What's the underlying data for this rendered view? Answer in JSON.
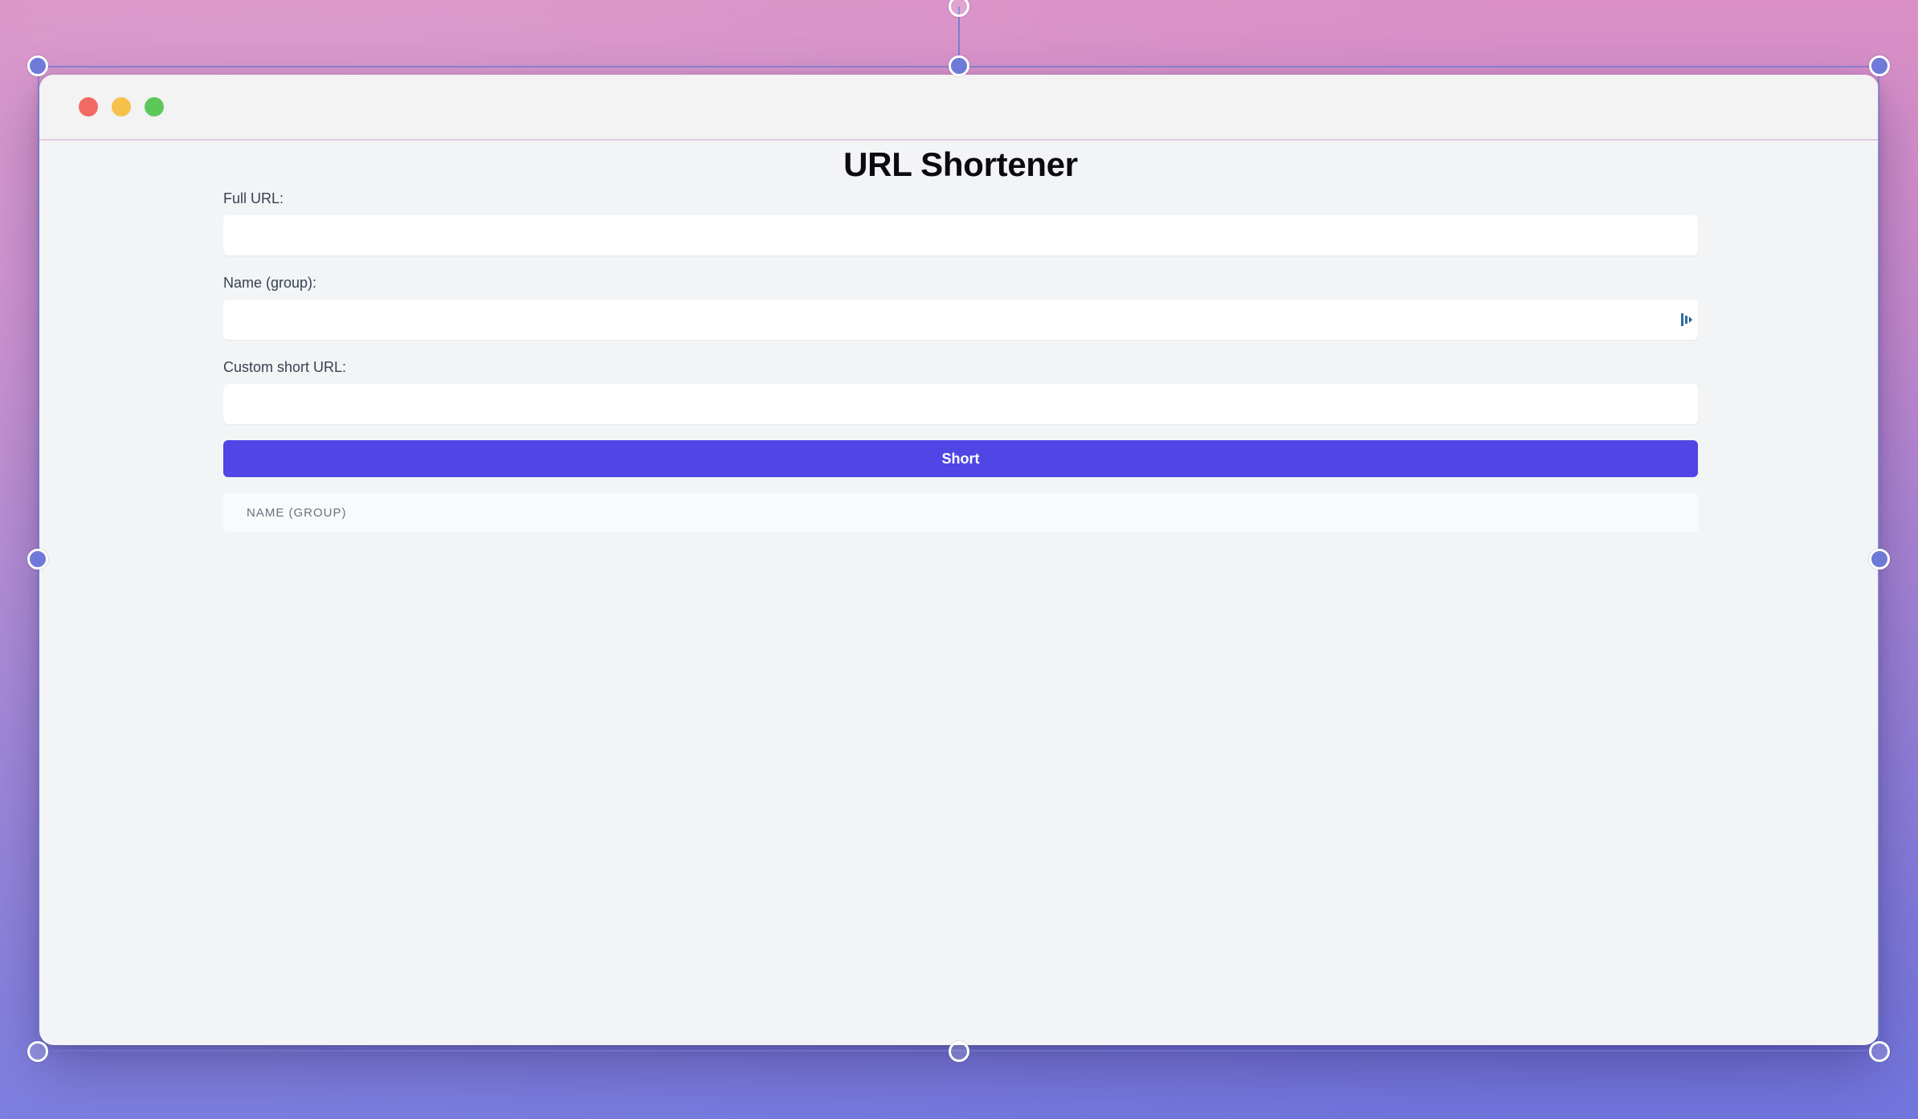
{
  "app": {
    "title": "URL Shortener"
  },
  "form": {
    "full_url": {
      "label": "Full URL:",
      "value": "",
      "placeholder": ""
    },
    "name_group": {
      "label": "Name (group):",
      "value": "",
      "placeholder": ""
    },
    "custom_short_url": {
      "label": "Custom short URL:",
      "value": "",
      "placeholder": ""
    },
    "submit_label": "Short"
  },
  "table": {
    "columns": [
      "NAME (GROUP)"
    ],
    "rows": []
  },
  "colors": {
    "accent": "#4f46e5",
    "window_bg": "#f3f4f6",
    "close": "#f26a63",
    "minimize": "#f6c14b",
    "maximize": "#5dc85a"
  }
}
